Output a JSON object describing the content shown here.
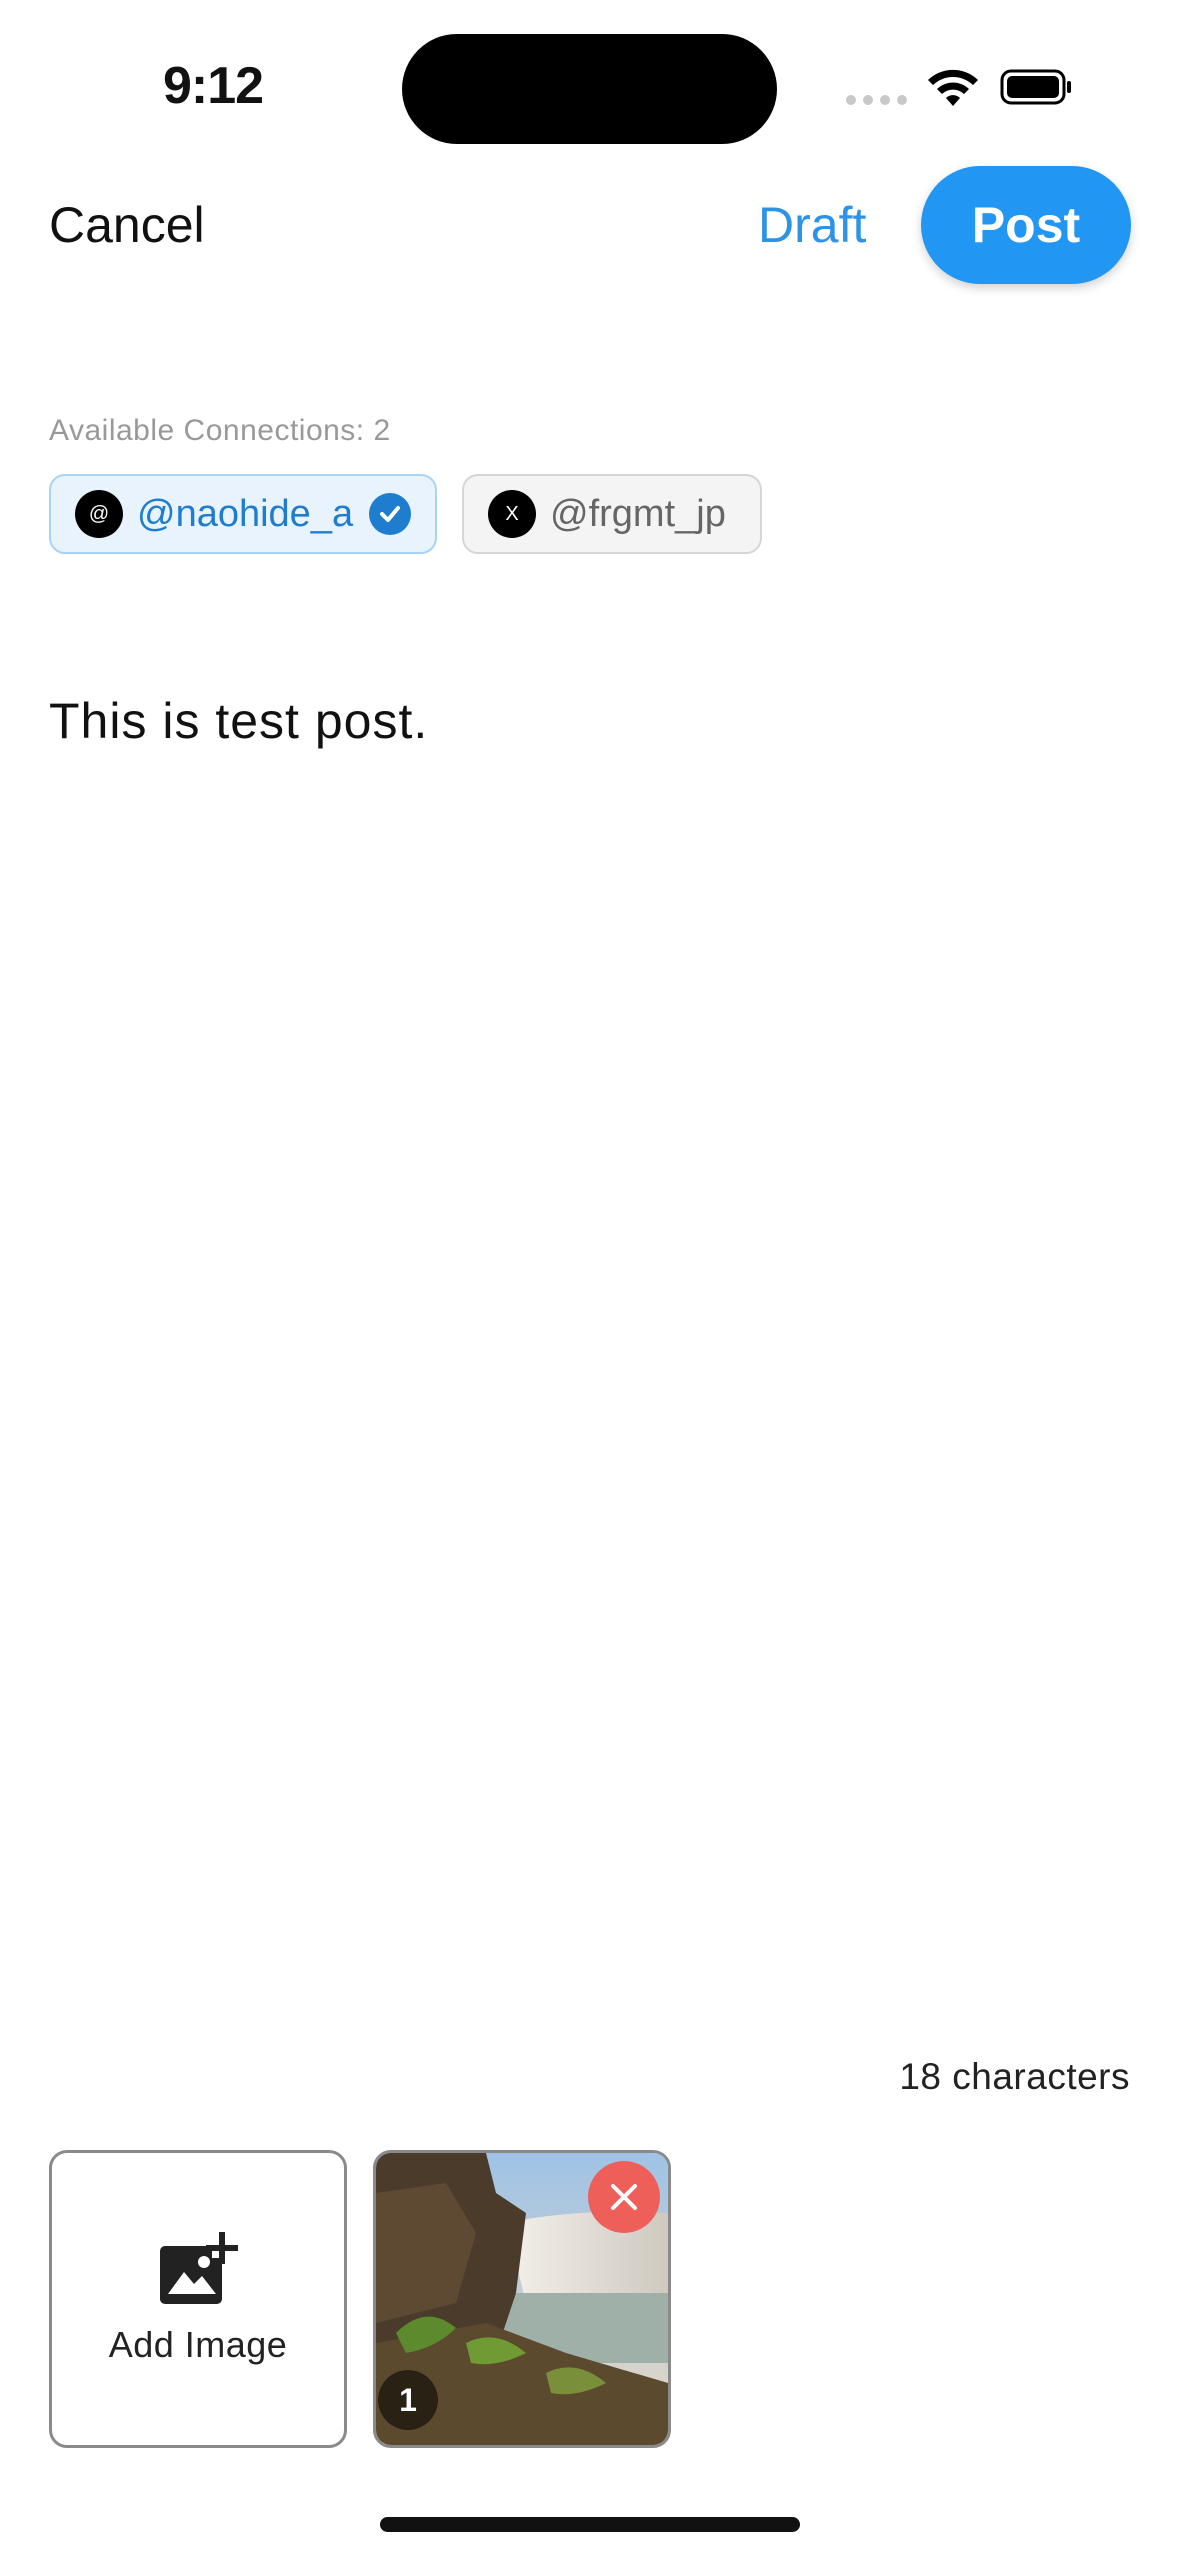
{
  "status_bar": {
    "time": "9:12"
  },
  "header": {
    "cancel_label": "Cancel",
    "draft_label": "Draft",
    "post_label": "Post"
  },
  "connections": {
    "label": "Available Connections: 2",
    "items": [
      {
        "handle": "@naohide_a",
        "avatar_glyph": "@",
        "selected": true
      },
      {
        "handle": "@frgmt_jp",
        "avatar_glyph": "X",
        "selected": false
      }
    ]
  },
  "editor": {
    "text": "This is test post."
  },
  "footer": {
    "char_count": "18 characters"
  },
  "images": {
    "add_label": "Add Image",
    "items": [
      {
        "index": "1"
      }
    ]
  },
  "colors": {
    "accent": "#2196f3",
    "selected_chip_bg": "#e8f3fd",
    "remove": "#ef5f5a"
  },
  "icons": [
    "wifi-icon",
    "battery-icon",
    "check-icon",
    "add-photo-icon",
    "close-icon"
  ]
}
